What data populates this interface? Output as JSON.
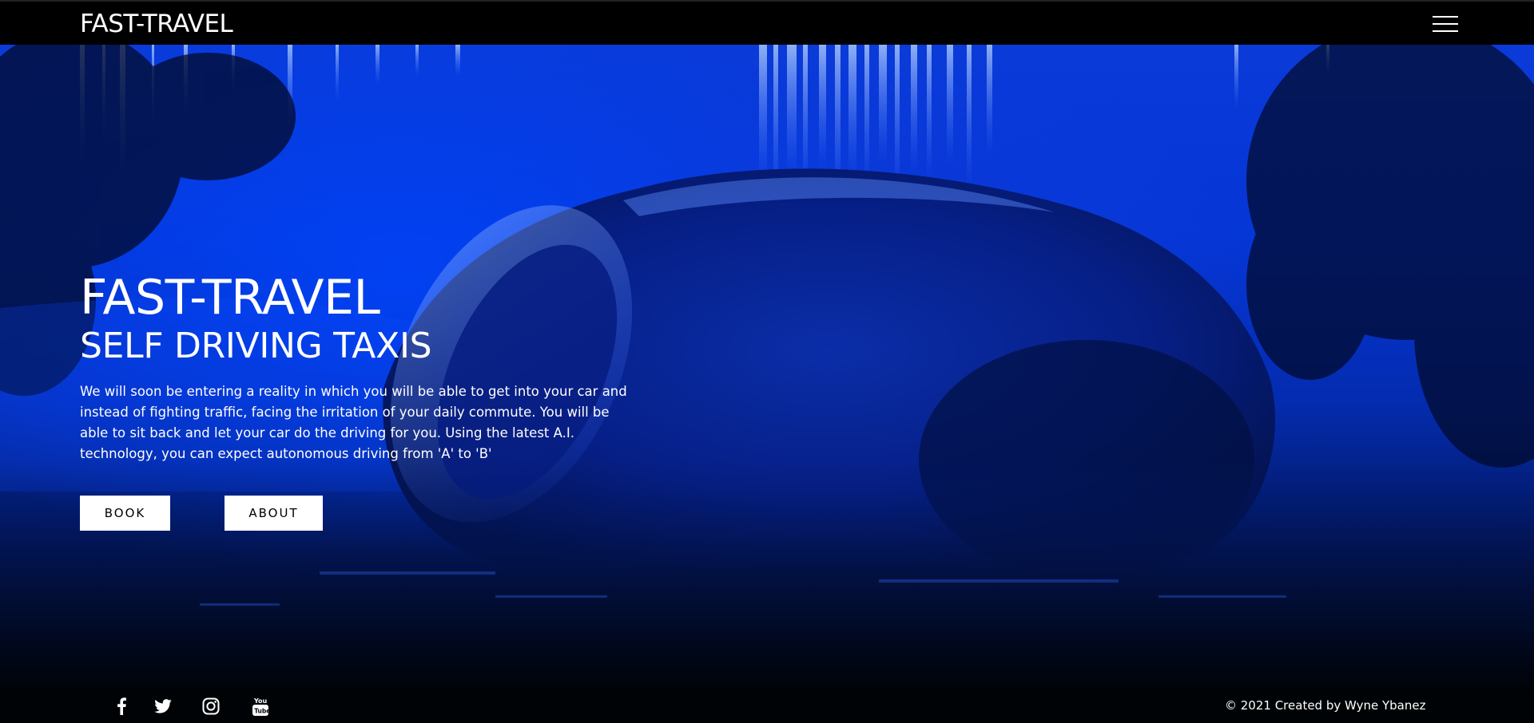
{
  "nav": {
    "brand": "FAST-TRAVEL",
    "menu_icon": "hamburger-menu-icon"
  },
  "hero": {
    "title": "FAST-TRAVEL",
    "subtitle": "SELF DRIVING TAXIS",
    "description": "We will soon be entering a reality in which you will be able to get into your car and instead of fighting traffic, facing the irritation of your daily commute. You will be able to sit back and let your car do the driving for you. Using the latest A.I. technology, you can expect autonomous driving from 'A' to 'B'",
    "buttons": {
      "book": "BOOK",
      "about": "ABOUT"
    },
    "background_image": "futuristic-car-blue-neon-image"
  },
  "footer": {
    "social": [
      {
        "icon": "facebook-icon"
      },
      {
        "icon": "twitter-icon"
      },
      {
        "icon": "instagram-icon"
      },
      {
        "icon": "youtube-icon"
      }
    ],
    "copyright": "© 2021 Created by Wyne Ybanez"
  },
  "colors": {
    "nav_bg": "#000000",
    "hero_blue": "#0536d6",
    "button_bg": "#ffffff",
    "button_text": "#000000"
  }
}
